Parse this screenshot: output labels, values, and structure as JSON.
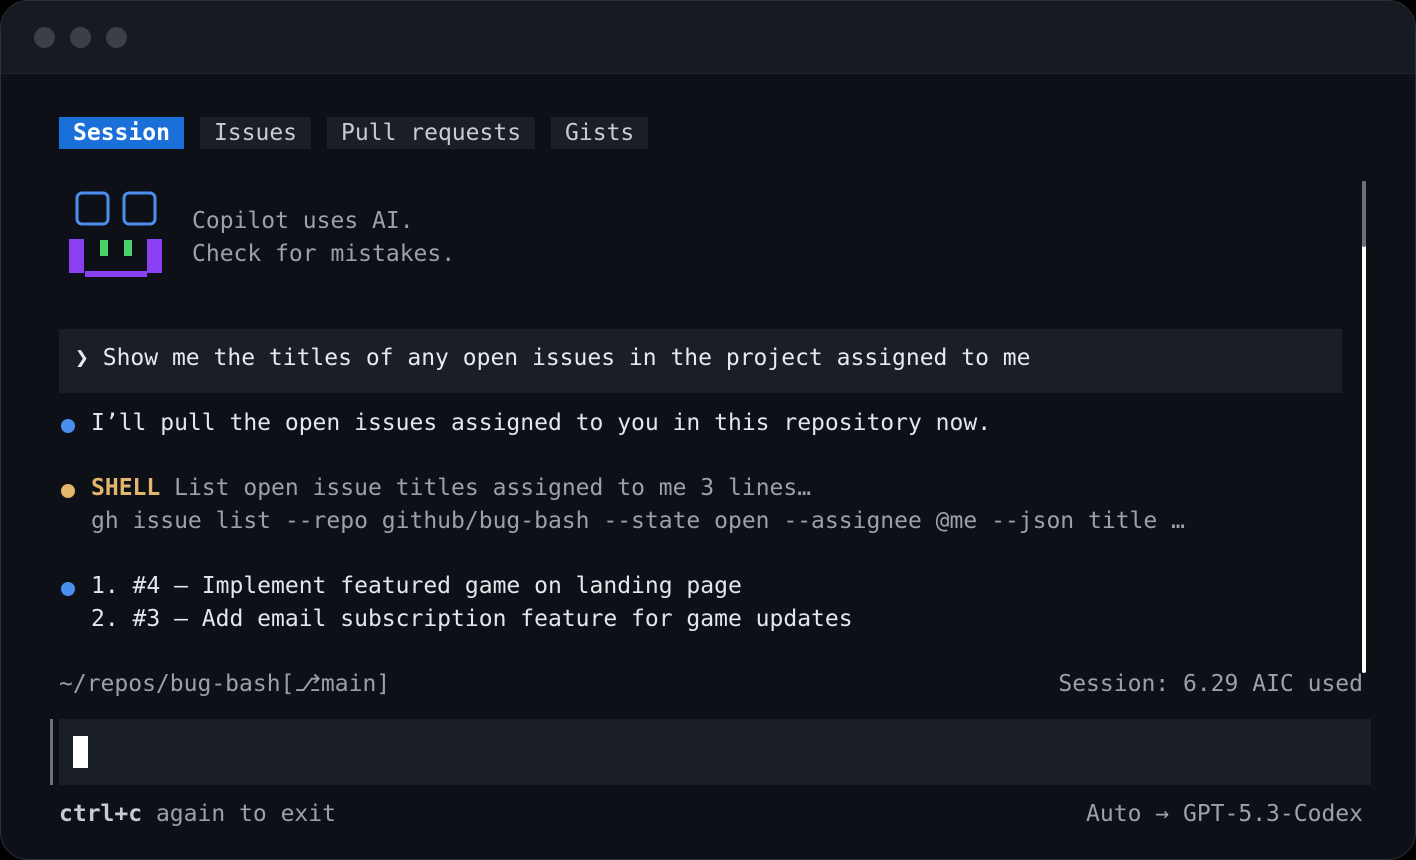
{
  "tabs": [
    {
      "label": "Session",
      "active": true
    },
    {
      "label": "Issues",
      "active": false
    },
    {
      "label": "Pull requests",
      "active": false
    },
    {
      "label": "Gists",
      "active": false
    }
  ],
  "banner": {
    "line1": "Copilot uses AI.",
    "line2": "Check for mistakes."
  },
  "prompt": {
    "chevron": "❯",
    "text": "Show me the titles of any open issues in the project assigned to me"
  },
  "messages": {
    "intro": "I’ll pull the open issues assigned to you in this repository now.",
    "shell_label": "SHELL",
    "shell_desc": "List open issue titles assigned to me 3 lines…",
    "shell_command": "gh issue list --repo github/bug-bash --state open --assignee @me --json title …",
    "results": [
      "1. #4 – Implement featured game on landing page",
      "2. #3 – Add email subscription feature for game updates"
    ]
  },
  "status": {
    "path": "~/repos/bug-bash[⎇main]",
    "session_usage": "Session: 6.29 AIC used"
  },
  "footer": {
    "key_hint": "ctrl+c",
    "key_hint_rest": " again to exit",
    "model": "Auto → GPT-5.3-Codex"
  },
  "colors": {
    "accent": "#1a6fd9",
    "info_bullet": "#4a8ff0",
    "shell_bullet": "#e3b66c",
    "logo_frame": "#4a8ff0",
    "logo_body": "#8a3ff0",
    "logo_eyes": "#4ad26a"
  }
}
